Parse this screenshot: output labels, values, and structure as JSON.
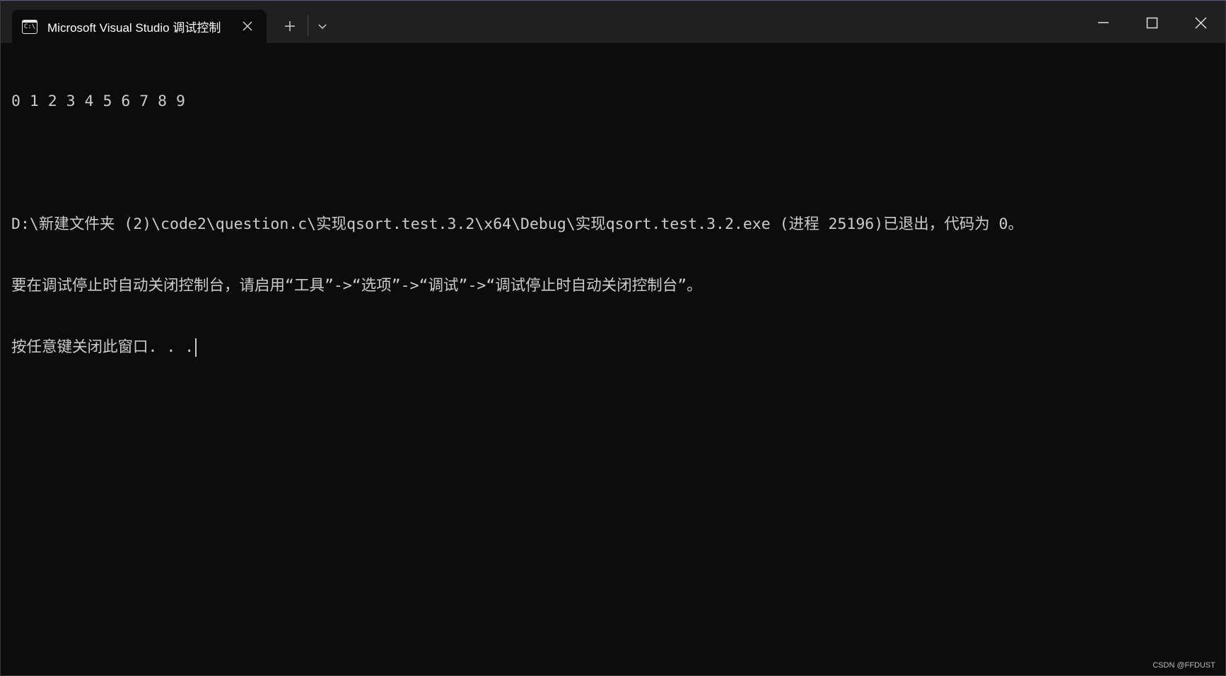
{
  "window": {
    "tab_title": "Microsoft Visual Studio 调试控制台",
    "tab_icon": "console-icon",
    "newtab_icon": "plus-icon",
    "dropdown_icon": "chevron-down-icon",
    "minimize_icon": "minimize-icon",
    "maximize_icon": "maximize-icon",
    "close_icon": "close-icon",
    "tab_icon_text": "C:\\"
  },
  "console": {
    "lines": [
      "0 1 2 3 4 5 6 7 8 9",
      "",
      "D:\\新建文件夹 (2)\\code2\\question.c\\实现qsort.test.3.2\\x64\\Debug\\实现qsort.test.3.2.exe (进程 25196)已退出，代码为 0。",
      "要在调试停止时自动关闭控制台，请启用“工具”->“选项”->“调试”->“调试停止时自动关闭控制台”。",
      "按任意键关闭此窗口. . ."
    ]
  },
  "watermark": "CSDN @FFDUST",
  "colors": {
    "background": "#0c0c0c",
    "titlebar": "#202020",
    "text": "#cccccc"
  }
}
